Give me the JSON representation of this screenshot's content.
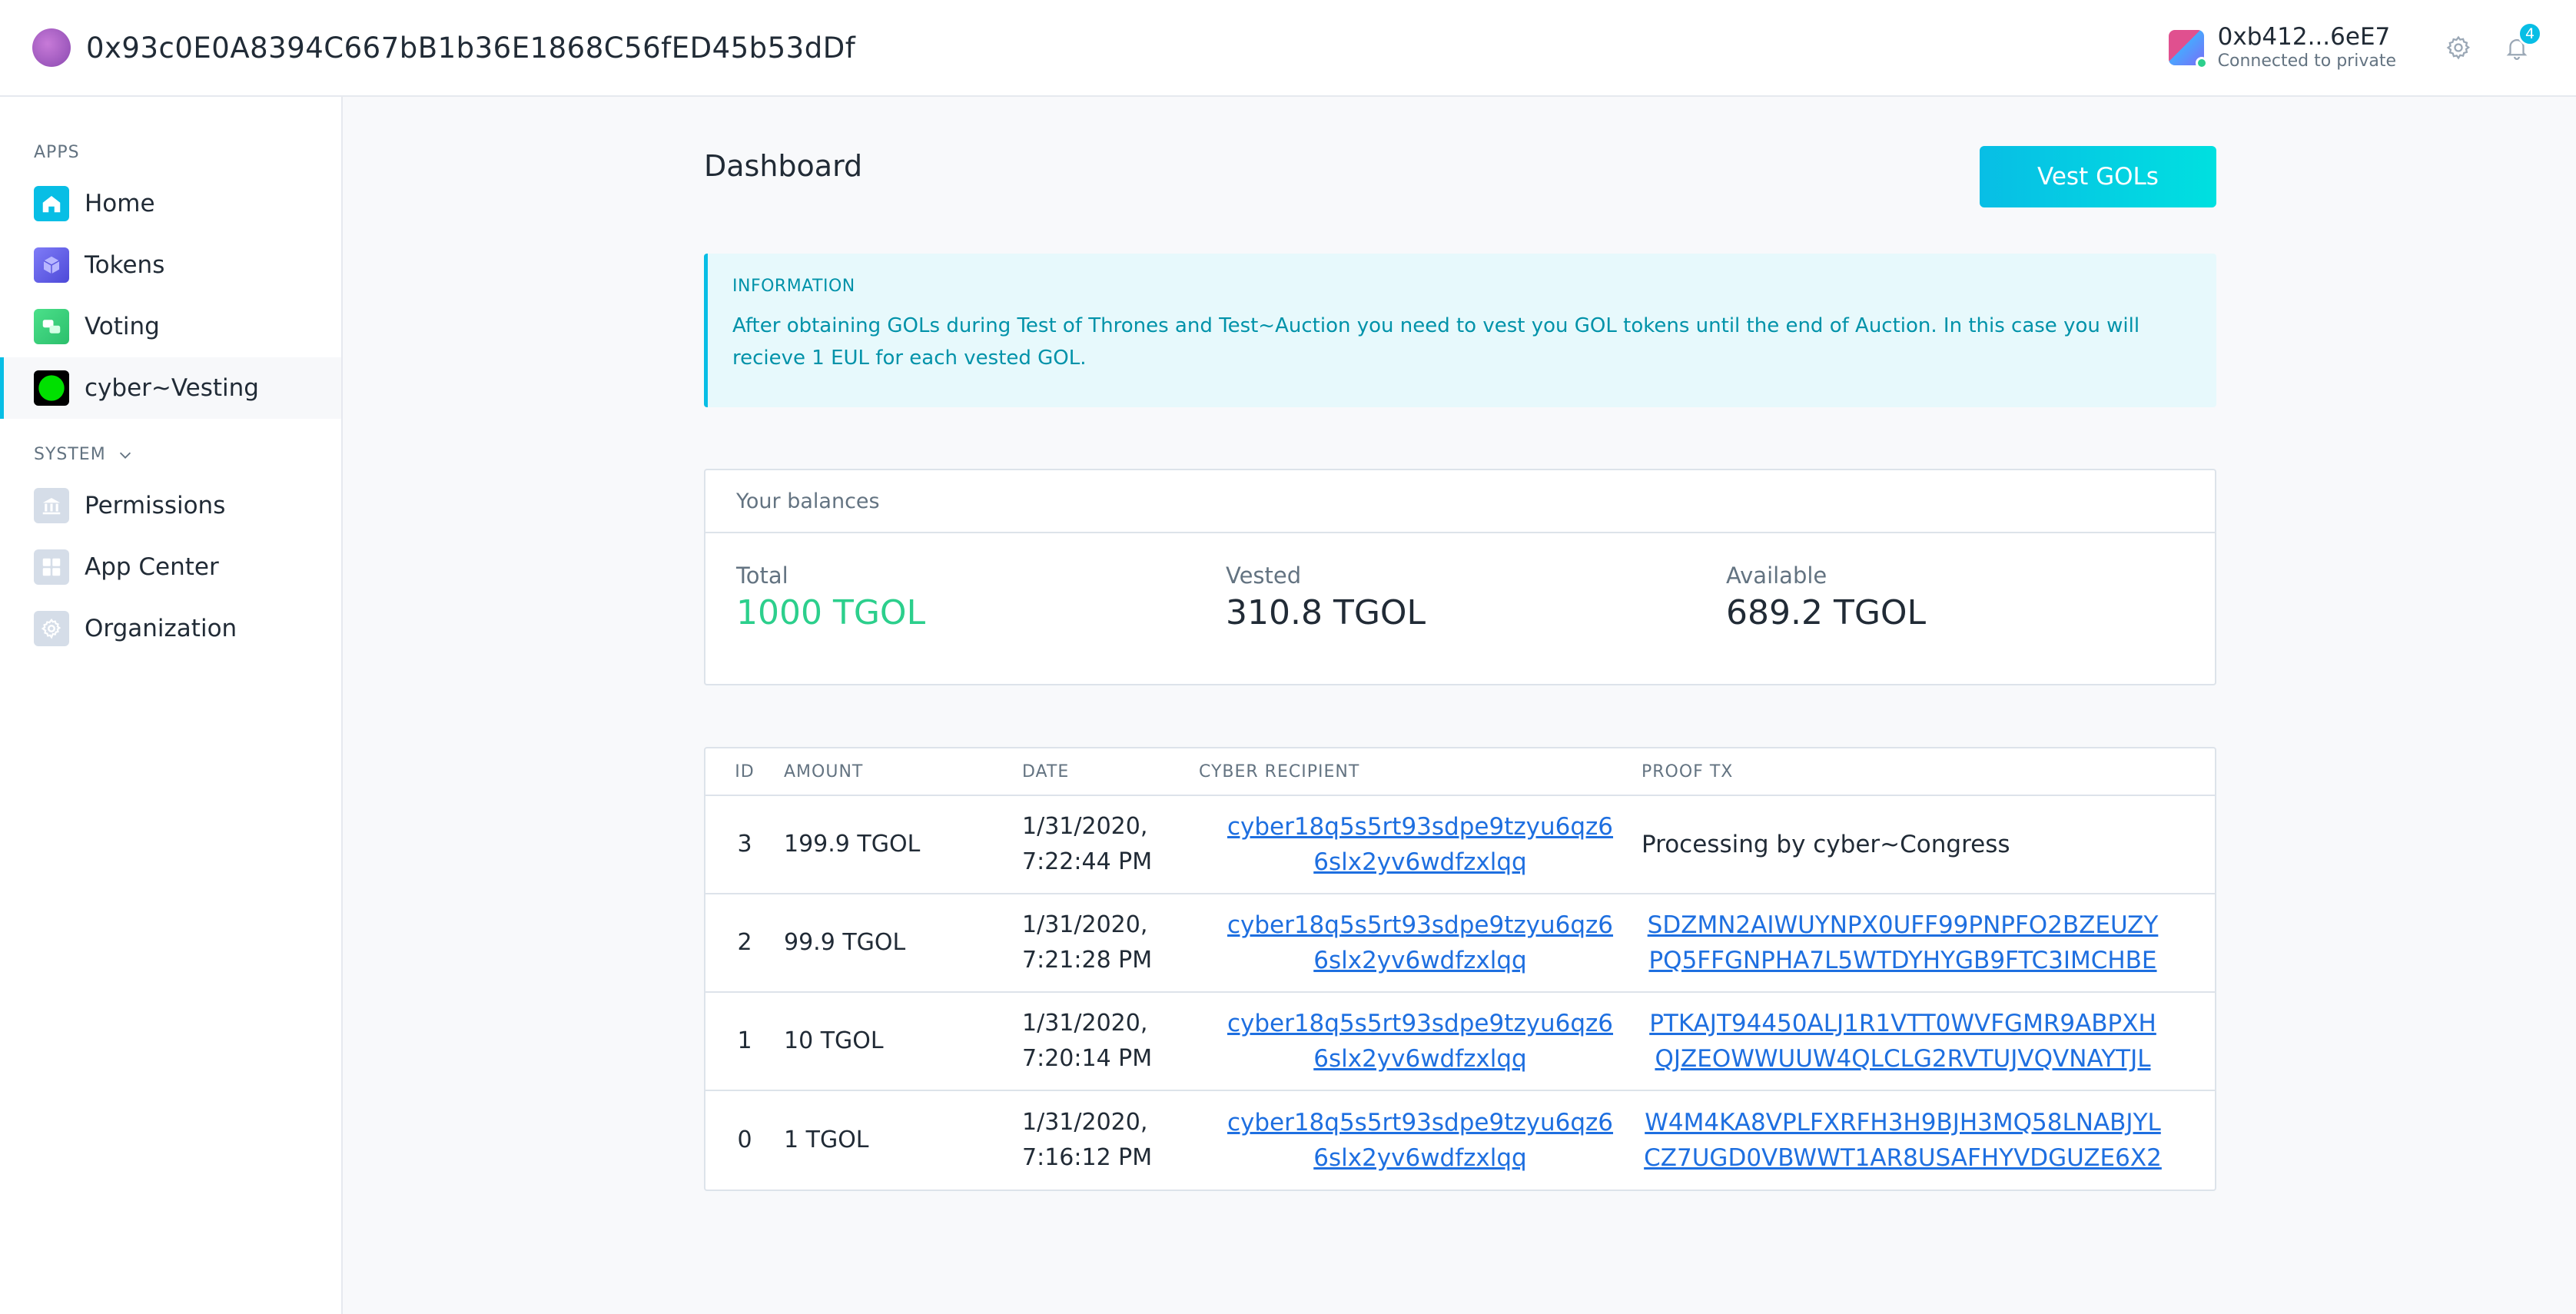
{
  "topbar": {
    "org_address": "0x93c0E0A8394C667bB1b36E1868C56fED45b53dDf",
    "account_address": "0xb412...6eE7",
    "account_network": "Connected to private",
    "notification_count": "4"
  },
  "sidebar": {
    "apps_label": "APPS",
    "system_label": "SYSTEM",
    "apps": [
      {
        "label": "Home",
        "icon": "home-icon",
        "color": "#08bee5"
      },
      {
        "label": "Tokens",
        "icon": "tokens-cube-icon",
        "color": "#6a68f5"
      },
      {
        "label": "Voting",
        "icon": "voting-icon",
        "color": "#37d67a"
      },
      {
        "label": "cyber~Vesting",
        "icon": "cyber-vesting-icon",
        "color": "#00e000"
      }
    ],
    "system": [
      {
        "label": "Permissions",
        "icon": "permissions-icon"
      },
      {
        "label": "App Center",
        "icon": "app-center-icon"
      },
      {
        "label": "Organization",
        "icon": "organization-gear-icon"
      }
    ]
  },
  "main": {
    "title": "Dashboard",
    "vest_button": "Vest GOLs",
    "info": {
      "title": "INFORMATION",
      "body": "After obtaining GOLs during Test of Thrones and Test~Auction you need to vest you GOL tokens until the end of Auction. In this case you will recieve 1 EUL for each vested GOL."
    },
    "balances": {
      "header": "Your balances",
      "total_label": "Total",
      "total_value": "1000 TGOL",
      "vested_label": "Vested",
      "vested_value": "310.8 TGOL",
      "available_label": "Available",
      "available_value": "689.2 TGOL"
    },
    "table": {
      "headers": [
        "ID",
        "AMOUNT",
        "DATE",
        "CYBER RECIPIENT",
        "PROOF TX"
      ],
      "rows": [
        {
          "id": "3",
          "amount": "199.9 TGOL",
          "date1": "1/31/2020,",
          "date2": "7:22:44 PM",
          "recipient": "cyber18q5s5rt93sdpe9tzyu6qz66slx2yv6wdfzxlqq",
          "proof": "Processing by cyber~Congress"
        },
        {
          "id": "2",
          "amount": "99.9 TGOL",
          "date1": "1/31/2020,",
          "date2": "7:21:28 PM",
          "recipient": "cyber18q5s5rt93sdpe9tzyu6qz66slx2yv6wdfzxlqq",
          "proof": "SDZMN2AIWUYNPX0UFF99PNPFO2BZEUZYPQ5FFGNPHA7L5WTDYHYGB9FTC3IMCHBE"
        },
        {
          "id": "1",
          "amount": "10 TGOL",
          "date1": "1/31/2020,",
          "date2": "7:20:14 PM",
          "recipient": "cyber18q5s5rt93sdpe9tzyu6qz66slx2yv6wdfzxlqq",
          "proof": "PTKAJT94450ALJ1R1VTT0WVFGMR9ABPXHQJZEOWWUUW4QLCLG2RVTUJVQVNAYTJL"
        },
        {
          "id": "0",
          "amount": "1 TGOL",
          "date1": "1/31/2020,",
          "date2": "7:16:12 PM",
          "recipient": "cyber18q5s5rt93sdpe9tzyu6qz66slx2yv6wdfzxlqq",
          "proof": "W4M4KA8VPLFXRFH3H9BJH3MQ58LNABJYLCZ7UGD0VBWWT1AR8USAFHYVDGUZE6X2"
        }
      ]
    }
  }
}
